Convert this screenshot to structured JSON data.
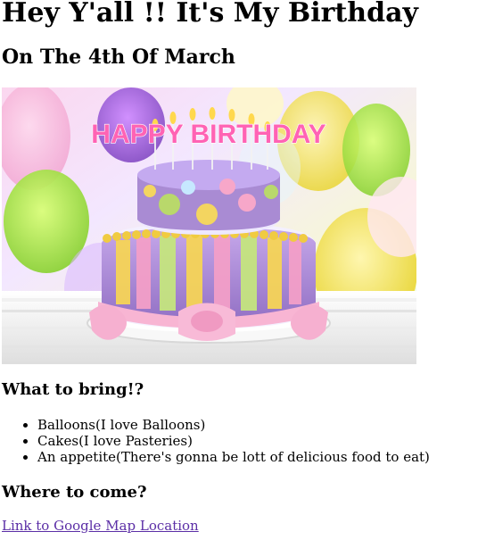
{
  "page": {
    "title": "Hey Y'all !! It's My Birthday",
    "subtitle": "On The 4th Of March"
  },
  "hero": {
    "cake_topper_text": "HAPPY BIRTHDAY"
  },
  "bring_section": {
    "heading": "What to bring!?",
    "items": [
      "Balloons(I love Balloons)",
      "Cakes(I love Pasteries)",
      "An appetite(There's gonna be lott of delicious food to eat)"
    ]
  },
  "where_section": {
    "heading": "Where to come?",
    "link_text": "Link to Google Map Location"
  },
  "colors": {
    "link": "#5b2ea6",
    "cake_purple": "#a98bd3",
    "cake_pink": "#f7a7c9",
    "cake_yellow": "#f3d560",
    "cake_green": "#b9d86b"
  },
  "icons": {
    "hero_illustration": "birthday-cake-icon"
  }
}
